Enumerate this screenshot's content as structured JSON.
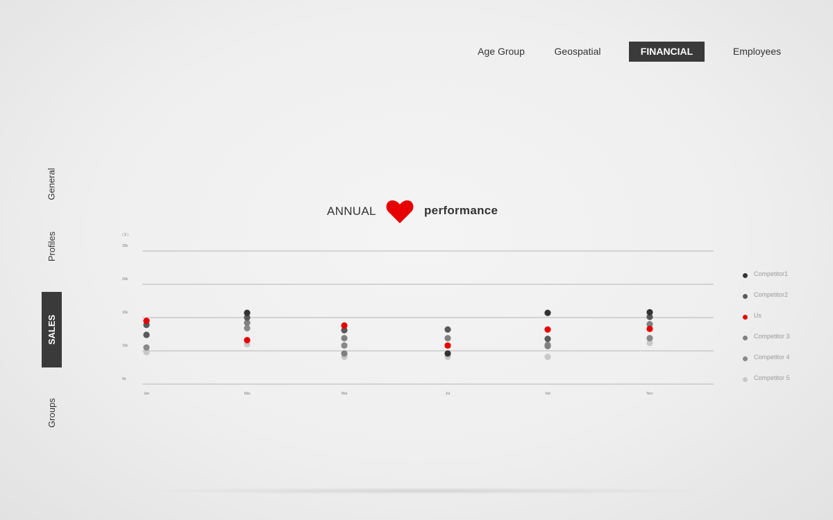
{
  "nav": {
    "items": [
      {
        "label": "Age Group",
        "active": false
      },
      {
        "label": "Geospatial",
        "active": false
      },
      {
        "label": "FINANCIAL",
        "active": true
      },
      {
        "label": "Employees",
        "active": false
      }
    ]
  },
  "sidebar": {
    "items": [
      {
        "label": "General",
        "active": false
      },
      {
        "label": "Profiles",
        "active": false
      },
      {
        "label": "SALES",
        "active": true
      },
      {
        "label": "Groups",
        "active": false
      }
    ]
  },
  "title": {
    "left": "ANNUAL",
    "right": "performance",
    "icon": "heart-icon",
    "icon_color": "#e60000"
  },
  "colors": {
    "accent": "#e60000",
    "active_bg": "#3a3a3a"
  },
  "chart_data": {
    "type": "scatter",
    "unit_label": "( $ )",
    "categories": [
      "Jan",
      "Mar",
      "Mai",
      "Jul",
      "Set",
      "Nov"
    ],
    "y_ticks": [
      "5k",
      "10k",
      "15k",
      "20k",
      "25k"
    ],
    "y_tick_values": [
      5,
      10,
      15,
      20,
      25
    ],
    "ylim": [
      5,
      25
    ],
    "grid": true,
    "legend_position": "right",
    "series": [
      {
        "name": "Competitor1",
        "color": "#333333",
        "values": [
          null,
          15.7,
          null,
          9.6,
          15.7,
          15.8
        ]
      },
      {
        "name": "Competitor2",
        "color": "#595959",
        "values": [
          13.9,
          15.0,
          13.1,
          13.2,
          11.8,
          15.1
        ]
      },
      {
        "name": "Us",
        "color": "#e60000",
        "values": [
          14.5,
          11.6,
          13.8,
          10.8,
          13.2,
          13.3
        ]
      },
      {
        "name": "Competitor 3",
        "color": "#808080",
        "values": [
          12.4,
          14.2,
          11.9,
          11.9,
          10.7,
          14.0
        ]
      },
      {
        "name": "Competitor 4",
        "color": "#888888",
        "values": [
          10.5,
          13.4,
          10.8,
          10.8,
          10.9,
          11.9
        ]
      },
      {
        "name": "Competitor 5",
        "color": "#c8c8c8",
        "values": [
          9.8,
          11.0,
          9.1,
          9.1,
          9.1,
          11.2
        ]
      }
    ],
    "extra_points": [
      {
        "series": "Competitor2",
        "category": "Jan",
        "value": 12.4
      },
      {
        "series": "Competitor 3",
        "category": "Mai",
        "value": 9.6
      }
    ]
  }
}
